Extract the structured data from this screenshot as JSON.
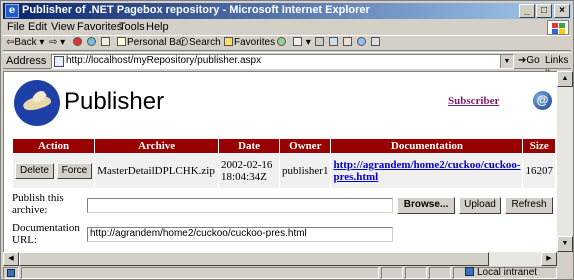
{
  "window": {
    "title": "Publisher of .NET Pagebox repository - Microsoft Internet Explorer",
    "app_icon": "e",
    "minimize": "_",
    "maximize": "□",
    "close": "×"
  },
  "menu": [
    "File",
    "Edit",
    "View",
    "Favorites",
    "Tools",
    "Help"
  ],
  "toolbar": {
    "back": "Back",
    "back_arrow": "⇦",
    "forward_arrow": "⇨",
    "personal_bar": "Personal Bar",
    "search": "Search",
    "favorites": "Favorites"
  },
  "address": {
    "label": "Address",
    "url": "http://localhost/myRepository/publisher.aspx",
    "go": "Go",
    "links": "Links"
  },
  "page": {
    "title": "Publisher",
    "subscribe": "Subscriber",
    "mail_icon": "@",
    "columns": [
      "Action",
      "Archive",
      "Date",
      "Owner",
      "Documentation",
      "Size"
    ],
    "rows": [
      {
        "delete_label": "Delete",
        "force_label": "Force",
        "archive": "MasterDetailDPLCHK.zip",
        "date": "2002-02-16 18:04:34Z",
        "owner": "publisher1",
        "documentation": "http://agrandem/home2/cuckoo/cuckoo-pres.html",
        "size": "16207"
      }
    ],
    "form": {
      "archive_label": "Publish this archive:",
      "archive_value": "",
      "browse_label": "Browse...",
      "upload_label": "Upload",
      "refresh_label": "Refresh",
      "doc_label": "Documentation URL:",
      "doc_value": "http://agrandem/home2/cuckoo/cuckoo-pres.html"
    }
  },
  "status": {
    "zone": "Local intranet"
  },
  "colors": {
    "header_bg": "#990000",
    "link": "#0000cc",
    "subscribe_link": "#7b1e6e",
    "titlebar_start": "#0a246a",
    "titlebar_end": "#a6caf0"
  },
  "icons": [
    "ie-icon",
    "back-icon",
    "forward-icon",
    "stop-icon",
    "refresh-icon",
    "home-icon",
    "search-icon",
    "favorites-icon",
    "history-icon",
    "mail-icon",
    "print-icon",
    "edit-icon",
    "publisher-logo",
    "zone-icon"
  ]
}
